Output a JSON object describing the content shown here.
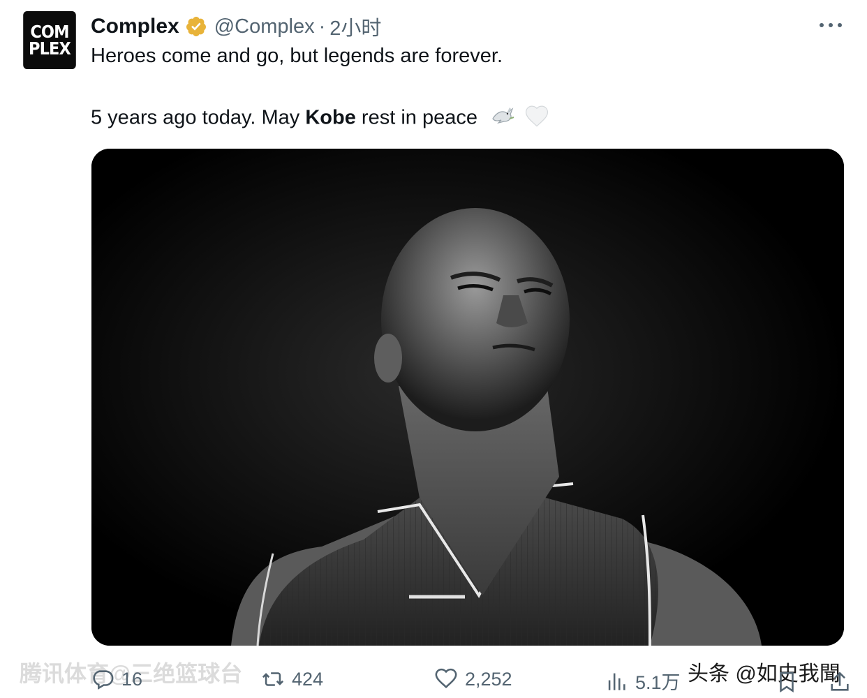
{
  "tweet": {
    "author": {
      "logo_line1": "COM",
      "logo_line2": "PLEX",
      "display_name": "Complex",
      "handle": "@Complex",
      "separator": "·",
      "timestamp": "2小时",
      "verified_icon": "verified-badge-icon",
      "verified_color": "#e8b339"
    },
    "text": {
      "line1": "Heroes come and go, but legends are forever.",
      "line2_prefix": "5 years ago today. May ",
      "line2_bold": "Kobe",
      "line2_suffix": " rest in peace",
      "emojis": [
        "dove-icon",
        "white-heart-icon"
      ]
    },
    "media": {
      "type": "image",
      "style": "black-and-white portrait photo"
    },
    "actions": {
      "replies": "16",
      "retweets": "424",
      "likes": "2,252",
      "views": "5.1万"
    }
  },
  "watermarks": {
    "left": "腾讯体育@三绝篮球台",
    "right": "头条 @如史我聞"
  },
  "colors": {
    "text_primary": "#0f1419",
    "text_secondary": "#536471",
    "logo_background": "#0b0b0b"
  }
}
